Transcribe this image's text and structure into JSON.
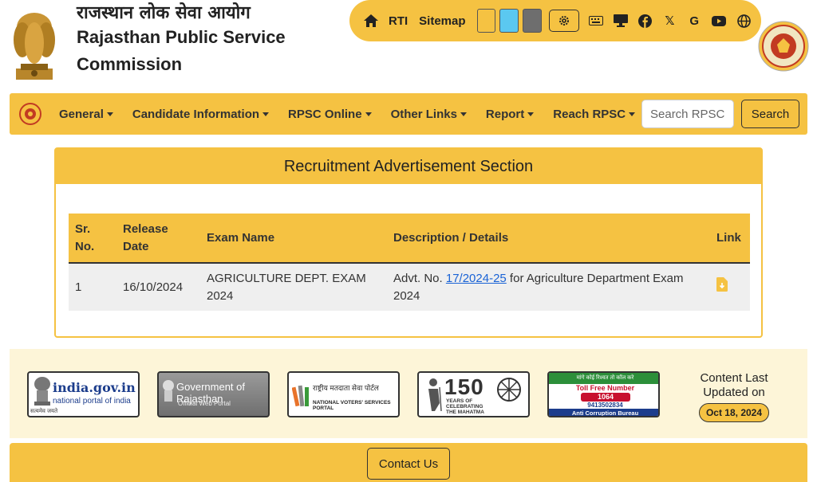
{
  "header": {
    "title_hindi": "राजस्थान लोक सेवा आयोग",
    "title_en_line1": "Rajasthan Public Service",
    "title_en_line2": "Commission"
  },
  "utility_bar": {
    "rti_label": "RTI",
    "sitemap_label": "Sitemap",
    "twitter_glyph": "𝕏",
    "google_glyph": "G",
    "swatches": [
      "#f5c242",
      "#5bc8f0",
      "#6e6e6e"
    ],
    "icons": [
      "home-icon",
      "settings-gear-icon",
      "keyboard-icon",
      "desktop-icon",
      "facebook-icon",
      "x-twitter-icon",
      "google-icon",
      "youtube-icon",
      "globe-icon"
    ]
  },
  "nav": {
    "items": [
      "General",
      "Candidate Information",
      "RPSC Online",
      "Other Links",
      "Report",
      "Reach RPSC"
    ],
    "search_placeholder": "Search RPSC",
    "search_button": "Search"
  },
  "section": {
    "title": "Recruitment Advertisement Section",
    "columns": {
      "sr_line1": "Sr.",
      "sr_line2": "No.",
      "date_line1": "Release",
      "date_line2": "Date",
      "exam": "Exam Name",
      "desc": "Description / Details",
      "link": "Link"
    },
    "rows": [
      {
        "sr": "1",
        "date": "16/10/2024",
        "exam_line1": "AGRICULTURE DEPT. EXAM",
        "exam_line2": "2024",
        "desc_prefix": "Advt. No. ",
        "desc_link": "17/2024-25",
        "desc_suffix": " for Agriculture Department Exam",
        "desc_line2": "2024"
      }
    ]
  },
  "footer_links": {
    "india_gov_main": "india.gov.in",
    "india_gov_sub": "national portal of india",
    "india_gov_caption": "सत्यमेव जयते",
    "gov_raj_main": "Government of Rajasthan",
    "gov_raj_sub": "Official Web Portal",
    "nvsp_hindi": "राष्ट्रीय मतदाता सेवा पोर्टल",
    "nvsp_en": "NATIONAL VOTERS' SERVICES PORTAL",
    "mahatma_num": "150",
    "mahatma_line1": "YEARS OF",
    "mahatma_line2": "CELEBRATING",
    "mahatma_line3": "THE MAHATMA",
    "acb_hindi": "मांगे कोई रिश्वत तो कॉल करे",
    "acb_tollfree": "Toll Free Number",
    "acb_number": "1064",
    "acb_whatsapp": "9413502834",
    "acb_name": "Anti Corruption Bureau"
  },
  "updated": {
    "line1": "Content Last",
    "line2": "Updated on",
    "date": "Oct 18, 2024"
  },
  "footer": {
    "contact_label": "Contact Us"
  },
  "colors": {
    "accent": "#f5c242",
    "link": "#1a63d6",
    "panel": "#fdf5d8"
  }
}
